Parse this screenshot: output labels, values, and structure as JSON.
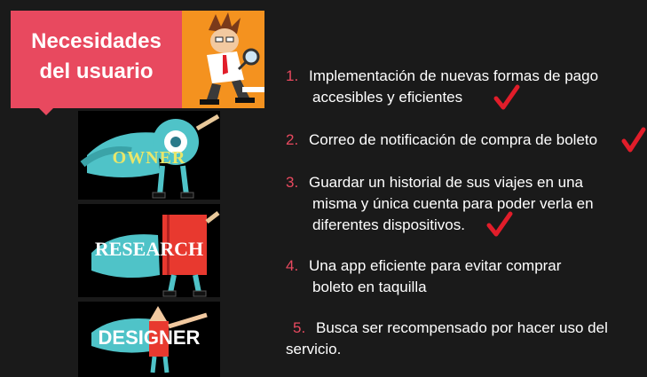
{
  "title": {
    "line1": "Necesidades",
    "line2": "del usuario"
  },
  "characters": [
    {
      "label": "OWNER"
    },
    {
      "label": "RESEARCH"
    },
    {
      "label": "DESIGNER"
    }
  ],
  "needs": [
    {
      "num": "1.",
      "line1": "Implementación de nuevas formas de pago",
      "line2": "accesibles y eficientes"
    },
    {
      "num": "2.",
      "line1": "Correo de notificación de compra de boleto",
      "line2": ""
    },
    {
      "num": "3.",
      "line1": "Guardar un historial de sus viajes en una",
      "line2": "misma y única cuenta  para poder verla en",
      "line3": "diferentes dispositivos."
    },
    {
      "num": "4.",
      "line1": "Una app eficiente  para evitar comprar",
      "line2": "boleto  en taquilla"
    },
    {
      "num": "5.",
      "line1": "Busca ser recompensado por hacer uso del",
      "line2": "servicio."
    }
  ],
  "colors": {
    "background": "#1a1a1a",
    "accent": "#e8495f",
    "orange": "#f4921f",
    "check": "#e11d2a"
  }
}
